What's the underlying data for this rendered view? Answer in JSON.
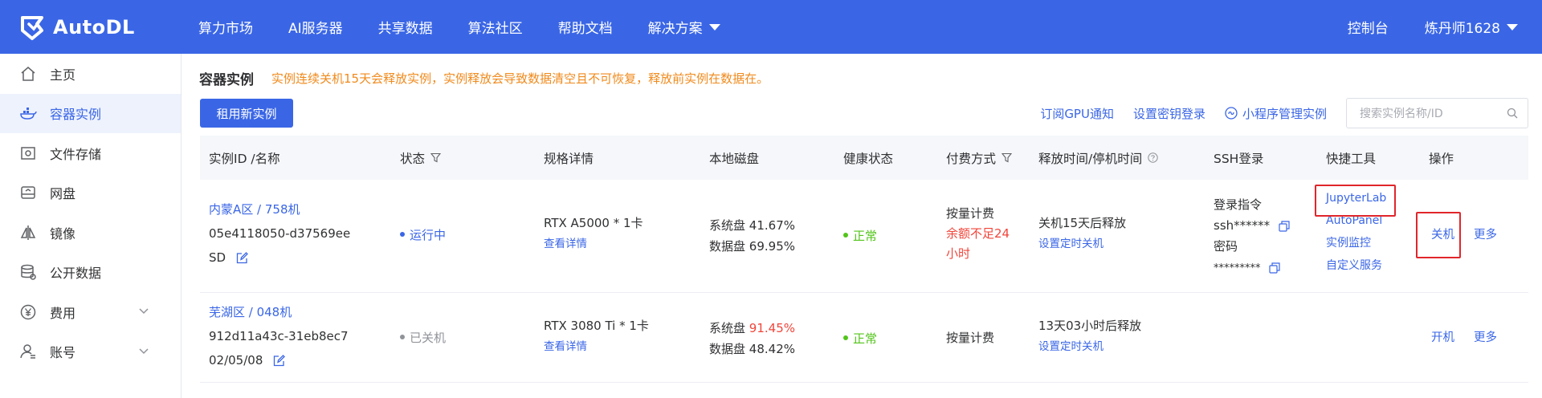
{
  "brand": "AutoDL",
  "nav": {
    "items": [
      "算力市场",
      "AI服务器",
      "共享数据",
      "算法社区",
      "帮助文档",
      "解决方案"
    ],
    "console": "控制台",
    "user": "炼丹师1628"
  },
  "sidebar": {
    "items": [
      {
        "label": "主页",
        "icon": "home-icon"
      },
      {
        "label": "容器实例",
        "icon": "container-icon"
      },
      {
        "label": "文件存储",
        "icon": "storage-icon"
      },
      {
        "label": "网盘",
        "icon": "disk-icon"
      },
      {
        "label": "镜像",
        "icon": "image-icon"
      },
      {
        "label": "公开数据",
        "icon": "database-icon"
      },
      {
        "label": "费用",
        "icon": "yen-icon"
      },
      {
        "label": "账号",
        "icon": "account-icon"
      }
    ]
  },
  "page": {
    "title": "容器实例",
    "warning": "实例连续关机15天会释放实例，实例释放会导致数据清空且不可恢复，释放前实例在数据在。",
    "new_button": "租用新实例",
    "links": {
      "gpu_notify": "订阅GPU通知",
      "ssh_key": "设置密钥登录",
      "mini_program": "小程序管理实例"
    },
    "search_placeholder": "搜索实例名称/ID"
  },
  "table": {
    "headers": {
      "id_name": "实例ID /名称",
      "status": "状态",
      "spec": "规格详情",
      "disk": "本地磁盘",
      "health": "健康状态",
      "billing": "付费方式",
      "release": "释放时间/停机时间",
      "ssh": "SSH登录",
      "tools": "快捷工具",
      "ops": "操作"
    },
    "rows": [
      {
        "name": "内蒙A区 / 758机",
        "id": "05e4118050-d37569ee",
        "alias": "SD",
        "status": "运行中",
        "spec": "RTX A5000 * 1卡",
        "spec_link": "查看详情",
        "sys_disk_label": "系统盘",
        "sys_disk": "41.67%",
        "data_disk_label": "数据盘",
        "data_disk": "69.95%",
        "health": "正常",
        "billing": "按量计费",
        "billing_warn_1": "余额不足24",
        "billing_warn_2": "小时",
        "release": "关机15天后释放",
        "release_link": "设置定时关机",
        "ssh_cmd_label": "登录指令",
        "ssh_cmd": "ssh******",
        "ssh_pwd_label": "密码",
        "ssh_pwd": "*********",
        "tools": [
          "JupyterLab",
          "AutoPanel",
          "实例监控",
          "自定义服务"
        ],
        "op_primary": "关机",
        "op_more": "更多"
      },
      {
        "name": "芜湖区 / 048机",
        "id": "912d11a43c-31eb8ec7",
        "alias": "02/05/08",
        "status": "已关机",
        "spec": "RTX 3080 Ti * 1卡",
        "spec_link": "查看详情",
        "sys_disk_label": "系统盘",
        "sys_disk": "91.45%",
        "data_disk_label": "数据盘",
        "data_disk": "48.42%",
        "health": "正常",
        "billing": "按量计费",
        "release": "13天03小时后释放",
        "release_link": "设置定时关机",
        "op_primary": "开机",
        "op_more": "更多"
      }
    ]
  },
  "colors": {
    "brand_blue": "#3a66e6",
    "warning_orange": "#f08a1c",
    "danger_red": "#f0453a",
    "ok_green": "#52c41a",
    "highlight_box": "#e0262b"
  }
}
